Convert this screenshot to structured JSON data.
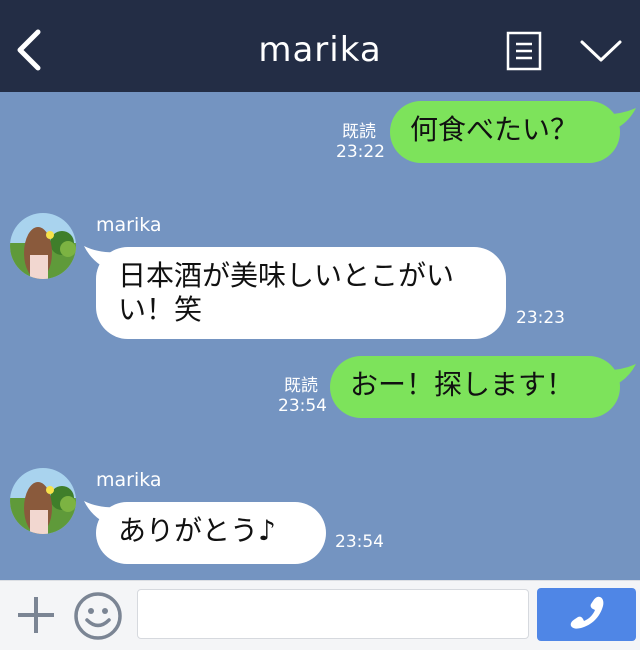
{
  "header": {
    "back_icon": "chevron-left-icon",
    "title": "marika",
    "menu_icon": "note-list-icon",
    "expand_icon": "chevron-down-icon"
  },
  "messages": [
    {
      "direction": "out",
      "text": "何食べたい？",
      "read": "既読",
      "time": "23:22"
    },
    {
      "direction": "in",
      "sender": "marika",
      "text": "日本酒が美味しいとこがいい！笑",
      "line1": "日本酒が美味しいとこがい",
      "line2": "い！笑",
      "time": "23:23"
    },
    {
      "direction": "out",
      "text": "おー！探します！",
      "read": "既読",
      "time": "23:54"
    },
    {
      "direction": "in",
      "sender": "marika",
      "text": "ありがとう♪",
      "time": "23:54"
    }
  ],
  "footer": {
    "plus_icon": "plus-icon",
    "emoji_icon": "smiley-icon",
    "input_value": "",
    "input_placeholder": "",
    "call_icon": "phone-icon"
  },
  "colors": {
    "header_bg": "#232d45",
    "chat_bg": "#7494c1",
    "outgoing_bubble": "#7de35b",
    "incoming_bubble": "#ffffff",
    "call_button": "#4f86e6"
  }
}
